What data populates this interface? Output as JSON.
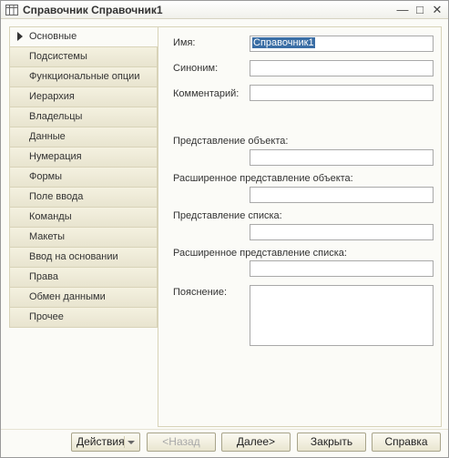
{
  "window": {
    "title": "Справочник Справочник1",
    "icon": "table-icon",
    "controls": {
      "minimize": "—",
      "maximize": "□",
      "close": "✕"
    }
  },
  "nav": {
    "items": [
      {
        "label": "Основные",
        "active": true
      },
      {
        "label": "Подсистемы"
      },
      {
        "label": "Функциональные опции"
      },
      {
        "label": "Иерархия"
      },
      {
        "label": "Владельцы"
      },
      {
        "label": "Данные"
      },
      {
        "label": "Нумерация"
      },
      {
        "label": "Формы"
      },
      {
        "label": "Поле ввода"
      },
      {
        "label": "Команды"
      },
      {
        "label": "Макеты"
      },
      {
        "label": "Ввод на основании"
      },
      {
        "label": "Права"
      },
      {
        "label": "Обмен данными"
      },
      {
        "label": "Прочее"
      }
    ]
  },
  "form": {
    "name_label": "Имя:",
    "name_value": "Справочник1",
    "synonym_label": "Синоним:",
    "synonym_value": "",
    "comment_label": "Комментарий:",
    "comment_value": "",
    "object_presentation_label": "Представление объекта:",
    "object_presentation_value": "",
    "ext_object_presentation_label": "Расширенное представление объекта:",
    "ext_object_presentation_value": "",
    "list_presentation_label": "Представление списка:",
    "list_presentation_value": "",
    "ext_list_presentation_label": "Расширенное представление списка:",
    "ext_list_presentation_value": "",
    "explanation_label": "Пояснение:",
    "explanation_value": ""
  },
  "footer": {
    "actions_label": "Действия",
    "back_label": "<Назад",
    "next_label": "Далее>",
    "close_label": "Закрыть",
    "help_label": "Справка"
  }
}
